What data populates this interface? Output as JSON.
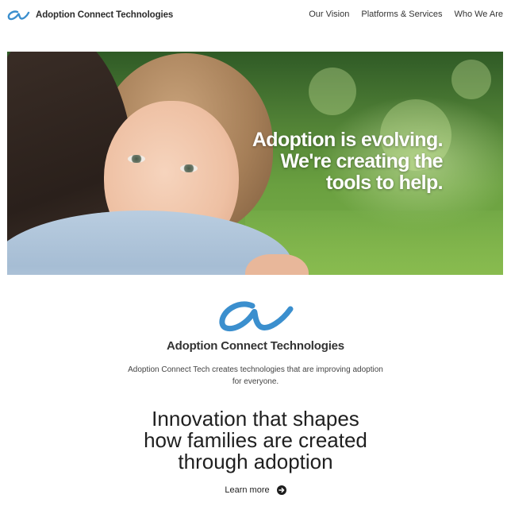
{
  "header": {
    "brand_name": "Adoption Connect Technologies",
    "logo_icon": "script-a-logo-icon",
    "nav": [
      {
        "label": "Our Vision"
      },
      {
        "label": "Platforms & Services"
      },
      {
        "label": "Who We Are"
      }
    ]
  },
  "hero": {
    "image": "mother-hugging-child-photo",
    "lines": [
      "Adoption is evolving.",
      "We're creating the",
      "tools to help."
    ]
  },
  "intro": {
    "company_name": "Adoption Connect Technologies",
    "tagline": "Adoption Connect Tech creates technologies that are improving adoption for everyone.",
    "headline_lines": [
      "Innovation that shapes",
      "how families are created",
      "through adoption"
    ],
    "learn_more_label": "Learn more",
    "learn_more_icon": "arrow-right-circle-icon"
  },
  "colors": {
    "brand_blue": "#3b8fce",
    "text_dark": "#222222"
  }
}
